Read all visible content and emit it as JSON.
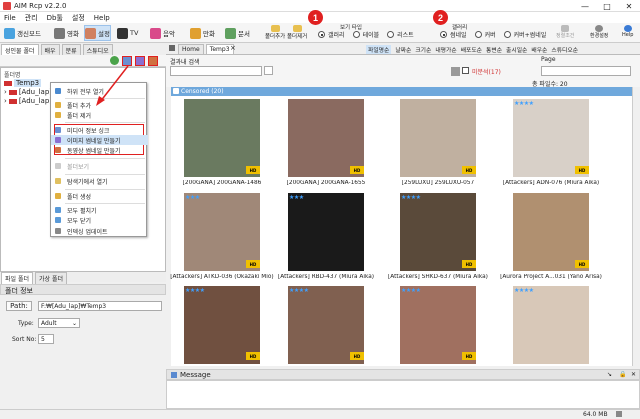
{
  "window": {
    "title": "AIM Rcp v2.2.0",
    "minimize": "—",
    "maximize": "□",
    "close": "✕"
  },
  "menu": [
    "File",
    "관리",
    "Db툴",
    "설정",
    "Help"
  ],
  "toolbar": {
    "buttons": [
      "갱신모드",
      "영화",
      "설정",
      "TV",
      "음악",
      "만화",
      "문서"
    ],
    "buttons2": [
      "폴더추가",
      "폴더제거"
    ],
    "view_type_label": "보기 타입",
    "view_types": [
      "갤러리",
      "테이블",
      "리스트"
    ],
    "gallery_label": "갤러리",
    "gallery_options": [
      "썸네일",
      "커버",
      "커버+썸네일"
    ],
    "right_buttons": [
      "정렬조건",
      "환경설정",
      "Help"
    ],
    "callout1": "1",
    "callout2": "2"
  },
  "left_panel": {
    "tabs": [
      "성인물 폴더",
      "배우",
      "분류",
      "스튜디오"
    ],
    "folder_list_label": "폴더명",
    "tree": [
      "Temp3",
      "[Adu_lap]",
      "[Adu_lap]"
    ],
    "bottom_tabs": [
      "파일 폴더",
      "가상 폴더"
    ]
  },
  "context_menu": {
    "items": [
      {
        "label": "하위 전부 열기",
        "disabled": false
      },
      {
        "label": "폴더 추가",
        "disabled": false
      },
      {
        "label": "폴더 제거",
        "disabled": false
      },
      {
        "label": "미디어 정보 싱크",
        "disabled": false
      },
      {
        "label": "이미지 썸네일 만들기",
        "disabled": false
      },
      {
        "label": "동영상 썸네일 만들기",
        "disabled": false
      },
      {
        "label": "볼더보기",
        "disabled": true
      },
      {
        "label": "탐색기에서 열기",
        "disabled": false
      },
      {
        "label": "폴더 생성",
        "disabled": false
      },
      {
        "label": "모두 펼치기",
        "disabled": false
      },
      {
        "label": "모두 닫기",
        "disabled": false
      },
      {
        "label": "인덱싱 업데이트",
        "disabled": false
      }
    ]
  },
  "folder_info": {
    "title": "폴더 정보",
    "path_label": "Path:",
    "path_value": "F:₩[Adu_lap]₩Temp3",
    "type_label": "Type:",
    "type_value": "Adult",
    "sort_label": "Sort No:",
    "sort_value": "5"
  },
  "main": {
    "tabs": [
      "Home",
      "Temp3"
    ],
    "subtabs": [
      "파일명순",
      "날짜순",
      "크기순",
      "내평가순",
      "배포도순",
      "통변순",
      "출시일순",
      "배우순",
      "스튜디오순"
    ],
    "search_label": "결과내 검색",
    "search_value": "",
    "unseen_label": "미분석(17)",
    "page_label": "Page",
    "total_label": "총 파일수: 20",
    "group_header": "Censored (20)",
    "items": [
      {
        "caption": "[200GANA] 200GANA-1486",
        "stars": 0,
        "hd": true
      },
      {
        "caption": "[200GANA] 200GANA-1655",
        "stars": 0,
        "hd": true
      },
      {
        "caption": "[259LUXU] 259LUXU-057",
        "stars": 0,
        "hd": true
      },
      {
        "caption": "[Attackers] ADN-076 (Miura Aika)",
        "stars": 4,
        "hd": true
      },
      {
        "caption": "[Attackers] ATKD-036 (Okazaki Mio)",
        "stars": 3,
        "hd": true
      },
      {
        "caption": "[Attackers] RBD-437 (Miura Aika)",
        "stars": 3,
        "hd": false
      },
      {
        "caption": "[Attackers] SHKD-637 (Miura Aika)",
        "stars": 4,
        "hd": true
      },
      {
        "caption": "[Aurora Project A...031 (Yano Arisa)",
        "stars": 0,
        "hd": true
      },
      {
        "caption": "",
        "stars": 4,
        "hd": true
      },
      {
        "caption": "",
        "stars": 4,
        "hd": true
      },
      {
        "caption": "",
        "stars": 4,
        "hd": true
      },
      {
        "caption": "",
        "stars": 4,
        "hd": false
      }
    ]
  },
  "message_panel": {
    "title": "Message"
  },
  "status": {
    "memory": "64.0 MB"
  },
  "colors": {
    "accent_red": "#e02020",
    "star_blue": "#3fa0ff",
    "header_blue": "#6fa8dc"
  }
}
